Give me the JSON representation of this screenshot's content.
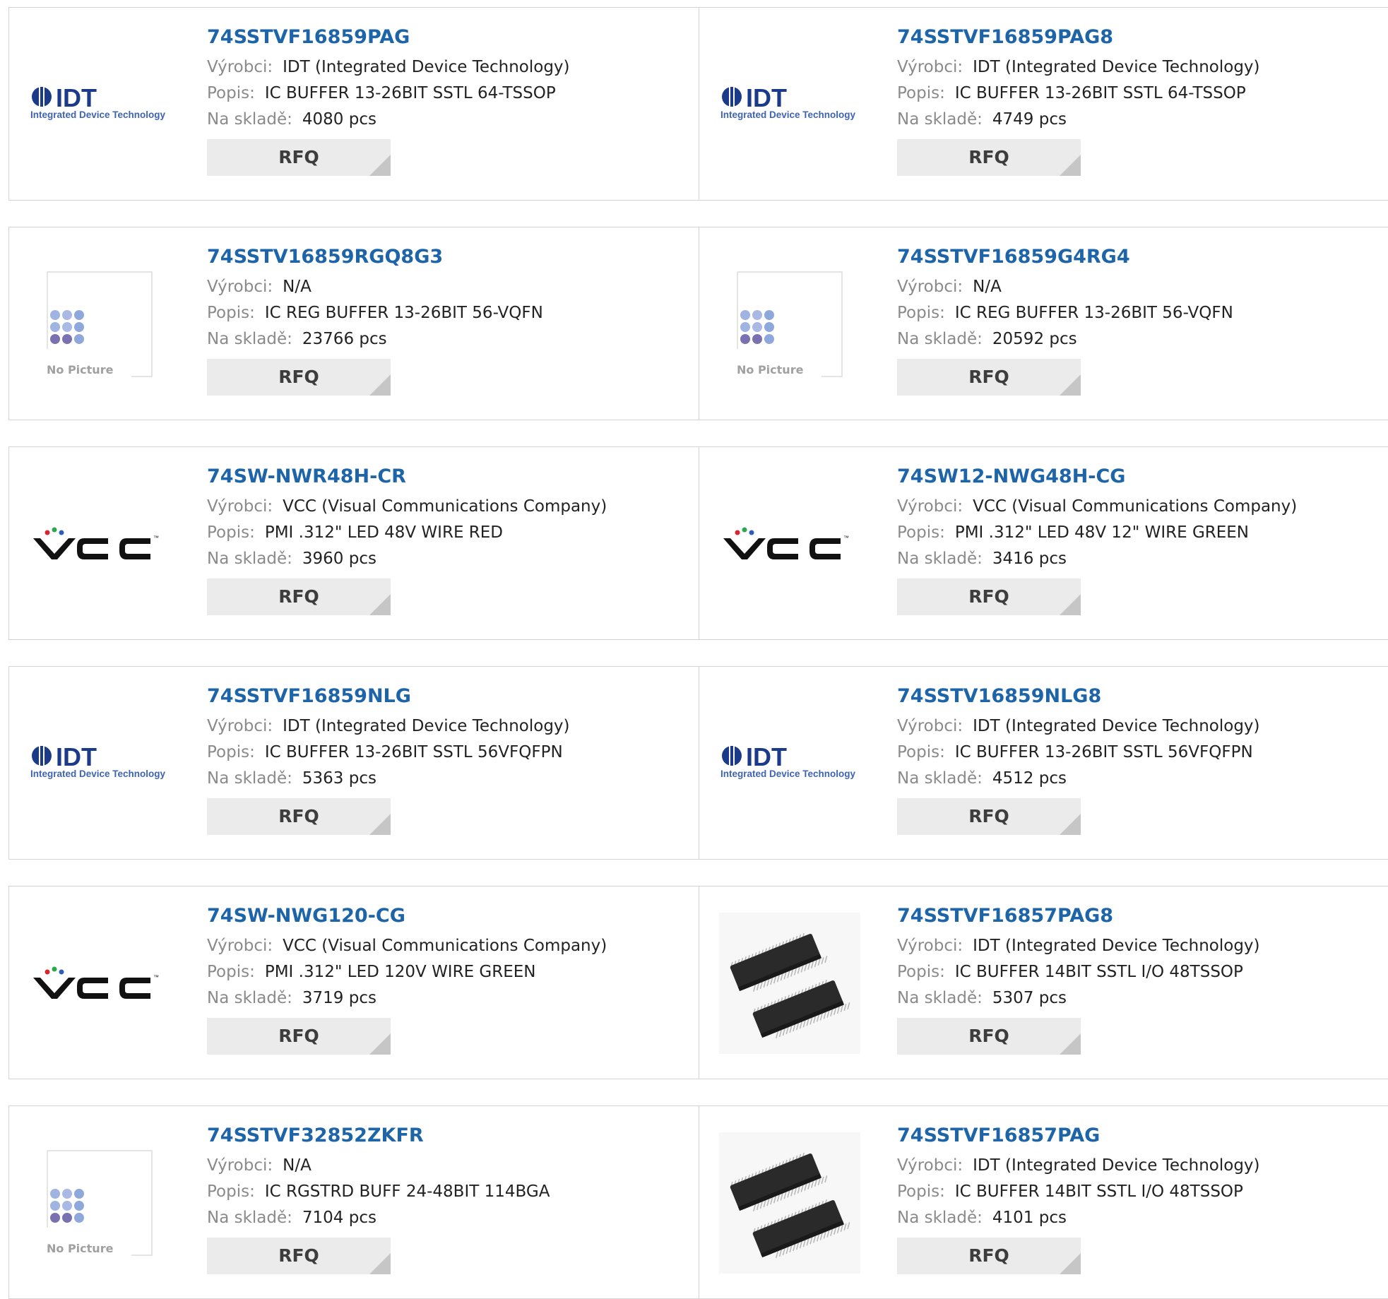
{
  "labels": {
    "manufacturer": "Výrobci:",
    "description": "Popis:",
    "stock": "Na skladě:",
    "rfq": "RFQ",
    "no_picture": "No Picture",
    "idt_logo_text": "IDT",
    "idt_logo_sub": "Integrated Device Technology",
    "vcc_logo_text": "VCC",
    "trademark": "™"
  },
  "colors": {
    "part_number": "#1d64a8",
    "label": "#8a8a8a",
    "rfq_bg": "#ebebeb",
    "border": "#d4d4d4"
  },
  "products": [
    {
      "part": "74SSTVF16859PAG",
      "manufacturer": "IDT (Integrated Device Technology)",
      "description": "IC BUFFER 13-26BIT SSTL 64-TSSOP",
      "stock": "4080 pcs",
      "image": "idt-logo"
    },
    {
      "part": "74SSTVF16859PAG8",
      "manufacturer": "IDT (Integrated Device Technology)",
      "description": "IC BUFFER 13-26BIT SSTL 64-TSSOP",
      "stock": "4749 pcs",
      "image": "idt-logo"
    },
    {
      "part": "74SSTV16859RGQ8G3",
      "manufacturer": "N/A",
      "description": "IC REG BUFFER 13-26BIT 56-VQFN",
      "stock": "23766 pcs",
      "image": "no-picture"
    },
    {
      "part": "74SSTVF16859G4RG4",
      "manufacturer": "N/A",
      "description": "IC REG BUFFER 13-26BIT 56-VQFN",
      "stock": "20592 pcs",
      "image": "no-picture"
    },
    {
      "part": "74SW-NWR48H-CR",
      "manufacturer": "VCC (Visual Communications Company)",
      "description": "PMI .312\" LED 48V WIRE RED",
      "stock": "3960 pcs",
      "image": "vcc-logo"
    },
    {
      "part": "74SW12-NWG48H-CG",
      "manufacturer": "VCC (Visual Communications Company)",
      "description": "PMI .312\" LED 48V 12\" WIRE GREEN",
      "stock": "3416 pcs",
      "image": "vcc-logo"
    },
    {
      "part": "74SSTVF16859NLG",
      "manufacturer": "IDT (Integrated Device Technology)",
      "description": "IC BUFFER 13-26BIT SSTL 56VFQFPN",
      "stock": "5363 pcs",
      "image": "idt-logo"
    },
    {
      "part": "74SSTV16859NLG8",
      "manufacturer": "IDT (Integrated Device Technology)",
      "description": "IC BUFFER 13-26BIT SSTL 56VFQFPN",
      "stock": "4512 pcs",
      "image": "idt-logo"
    },
    {
      "part": "74SW-NWG120-CG",
      "manufacturer": "VCC (Visual Communications Company)",
      "description": "PMI .312\" LED 120V WIRE GREEN",
      "stock": "3719 pcs",
      "image": "vcc-logo"
    },
    {
      "part": "74SSTVF16857PAG8",
      "manufacturer": "IDT (Integrated Device Technology)",
      "description": "IC BUFFER 14BIT SSTL I/O 48TSSOP",
      "stock": "5307 pcs",
      "image": "chip-photo"
    },
    {
      "part": "74SSTVF32852ZKFR",
      "manufacturer": "N/A",
      "description": "IC RGSTRD BUFF 24-48BIT 114BGA",
      "stock": "7104 pcs",
      "image": "no-picture"
    },
    {
      "part": "74SSTVF16857PAG",
      "manufacturer": "IDT (Integrated Device Technology)",
      "description": "IC BUFFER 14BIT SSTL I/O 48TSSOP",
      "stock": "4101 pcs",
      "image": "chip-photo"
    }
  ]
}
